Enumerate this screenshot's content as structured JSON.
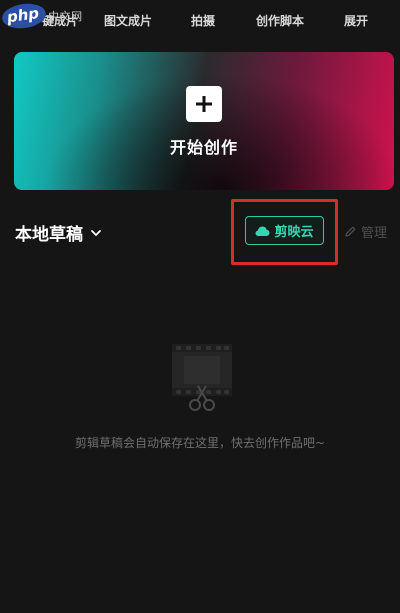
{
  "watermark": {
    "logo": "php",
    "site": "中文网"
  },
  "toolbar": {
    "items": [
      {
        "label": "一键成片"
      },
      {
        "label": "图文成片"
      },
      {
        "label": "拍摄"
      },
      {
        "label": "创作脚本"
      },
      {
        "label": "展开"
      }
    ]
  },
  "create": {
    "label": "开始创作",
    "icon": "plus-icon"
  },
  "drafts": {
    "title": "本地草稿",
    "cloud_button": "剪映云",
    "manage_label": "管理"
  },
  "empty_state": {
    "icon": "film-scissors-icon",
    "message": "剪辑草稿会自动保存在这里，快去创作作品吧~"
  },
  "colors": {
    "accent": "#34d7b1",
    "highlight": "#d62c2c",
    "background": "#151515"
  }
}
